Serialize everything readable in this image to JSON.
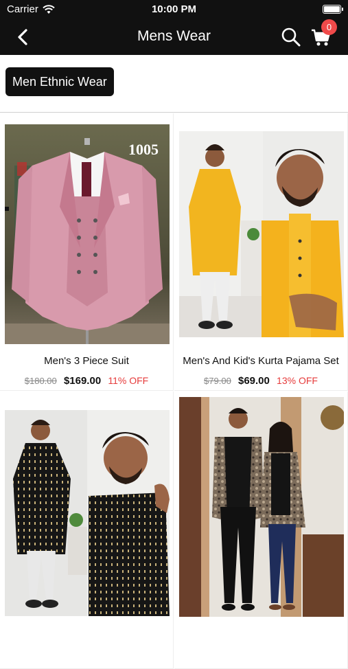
{
  "status_bar": {
    "carrier": "Carrier",
    "time": "10:00 PM"
  },
  "navbar": {
    "title": "Mens Wear",
    "cart_count": "0"
  },
  "category_chip": {
    "label": "Men Ethnic Wear"
  },
  "products": [
    {
      "name": "Men's 3 Piece Suit",
      "old_price": "$180.00",
      "price": "$169.00",
      "discount": "11% OFF",
      "image_label": "1005"
    },
    {
      "name": "Men's And Kid's Kurta Pajama Set",
      "old_price": "$79.00",
      "price": "$69.00",
      "discount": "13% OFF"
    },
    {
      "name": "",
      "old_price": "",
      "price": "",
      "discount": ""
    },
    {
      "name": "",
      "old_price": "",
      "price": "",
      "discount": ""
    }
  ],
  "colors": {
    "nav_bg": "#111111",
    "badge": "#f04a4a",
    "discount": "#e63b3b"
  },
  "icons": [
    "wifi-icon",
    "battery-icon",
    "back-chevron-icon",
    "search-icon",
    "cart-icon"
  ]
}
